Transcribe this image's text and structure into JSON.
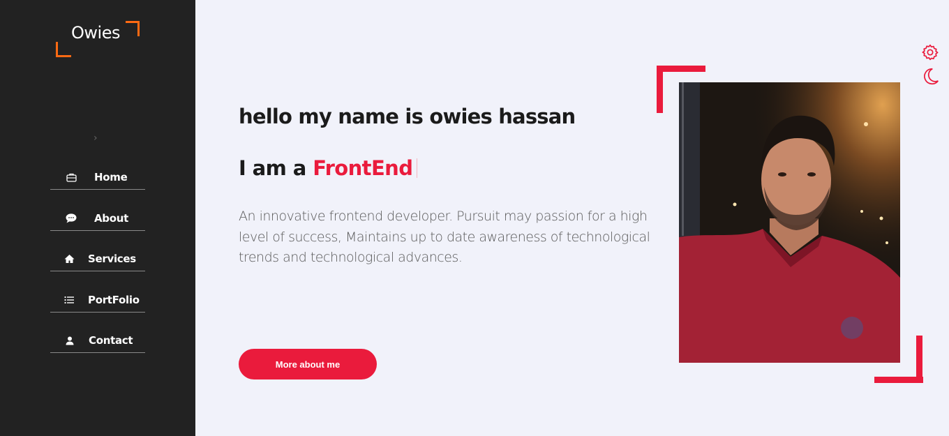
{
  "brand": {
    "logo_text": "Owies",
    "accent_color": "#ea1b3c",
    "logo_corner_color": "#ff6a13"
  },
  "sidebar": {
    "collapse_icon": "chevron-right-icon",
    "items": [
      {
        "label": "Home",
        "icon": "briefcase-icon"
      },
      {
        "label": "About",
        "icon": "chat-bubble-icon"
      },
      {
        "label": "Services",
        "icon": "house-icon"
      },
      {
        "label": "PortFolio",
        "icon": "list-icon"
      },
      {
        "label": "Contact",
        "icon": "user-icon"
      }
    ]
  },
  "hero": {
    "greeting": "hello my name is owies hassan",
    "role_prefix": "I am a ",
    "role_highlight": "FrontEnd",
    "bio": "An innovative frontend developer. Pursuit may passion for a high level of success, Maintains up to date awareness of technological trends and technological advances.",
    "cta_label": "More about me"
  },
  "toolbar": {
    "settings_icon": "gear-icon",
    "theme_icon": "moon-icon"
  }
}
